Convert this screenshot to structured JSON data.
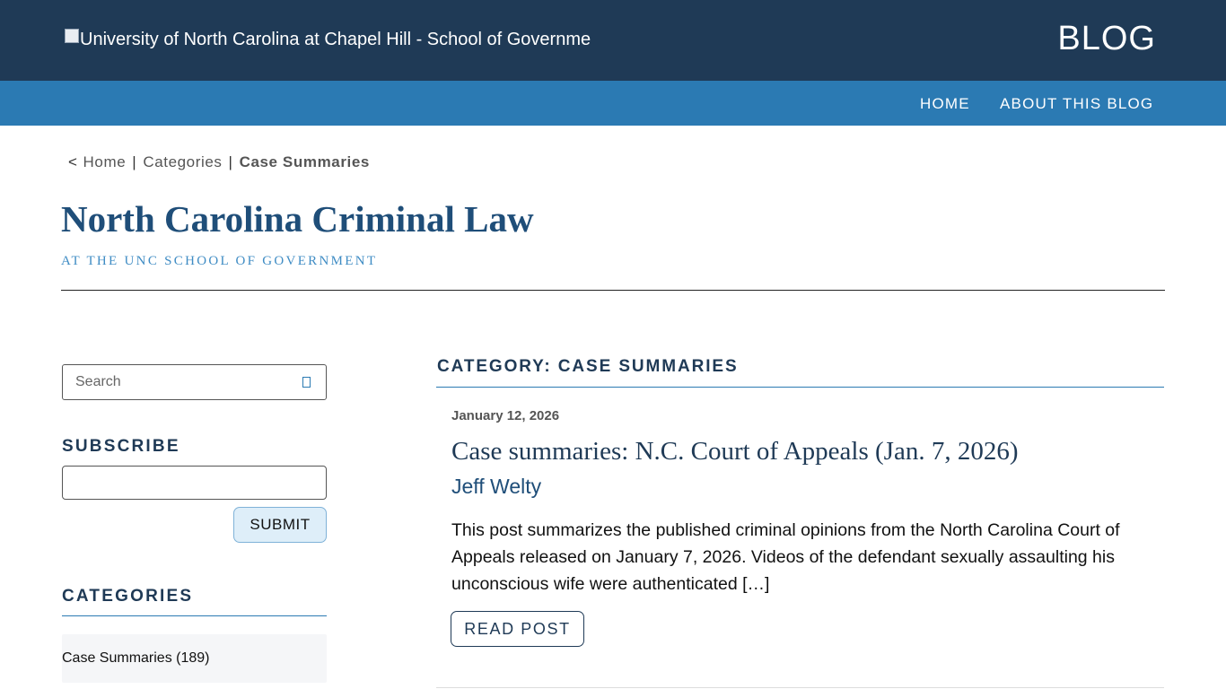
{
  "header": {
    "logo_alt": "University of North Carolina at Chapel Hill - School of Governme",
    "blog_label": "BLOG"
  },
  "nav": {
    "items": [
      {
        "label": "HOME"
      },
      {
        "label": "ABOUT THIS BLOG"
      }
    ]
  },
  "breadcrumb": {
    "caret": "<",
    "items": [
      {
        "label": "Home"
      },
      {
        "label": "Categories"
      },
      {
        "label": "Case Summaries"
      }
    ],
    "separator": "|"
  },
  "site": {
    "title": "North Carolina Criminal Law",
    "subtitle": "AT THE UNC SCHOOL OF GOVERNMENT"
  },
  "sidebar": {
    "search_placeholder": "Search",
    "search_icon": "search-icon",
    "subscribe_heading": "SUBSCRIBE",
    "subscribe_value": "",
    "submit_label": "SUBMIT",
    "categories_heading": "CATEGORIES",
    "categories": [
      {
        "label": "Case Summaries (189)"
      }
    ]
  },
  "main": {
    "category_title": "CATEGORY: CASE SUMMARIES",
    "posts": [
      {
        "date": "January 12, 2026",
        "title": "Case summaries: N.C. Court of Appeals (Jan. 7, 2026)",
        "author": "Jeff Welty",
        "excerpt": "This post summarizes the published criminal opinions from the North Carolina Court of Appeals released on January 7, 2026. Videos of the defendant sexually assaulting his unconscious wife were authenticated […]",
        "button_label": "READ POST"
      }
    ]
  },
  "colors": {
    "header_bg": "#1f3a56",
    "nav_bg": "#2b7ab3",
    "title_blue": "#1f4e79",
    "subtitle_blue": "#3f8cc4"
  }
}
